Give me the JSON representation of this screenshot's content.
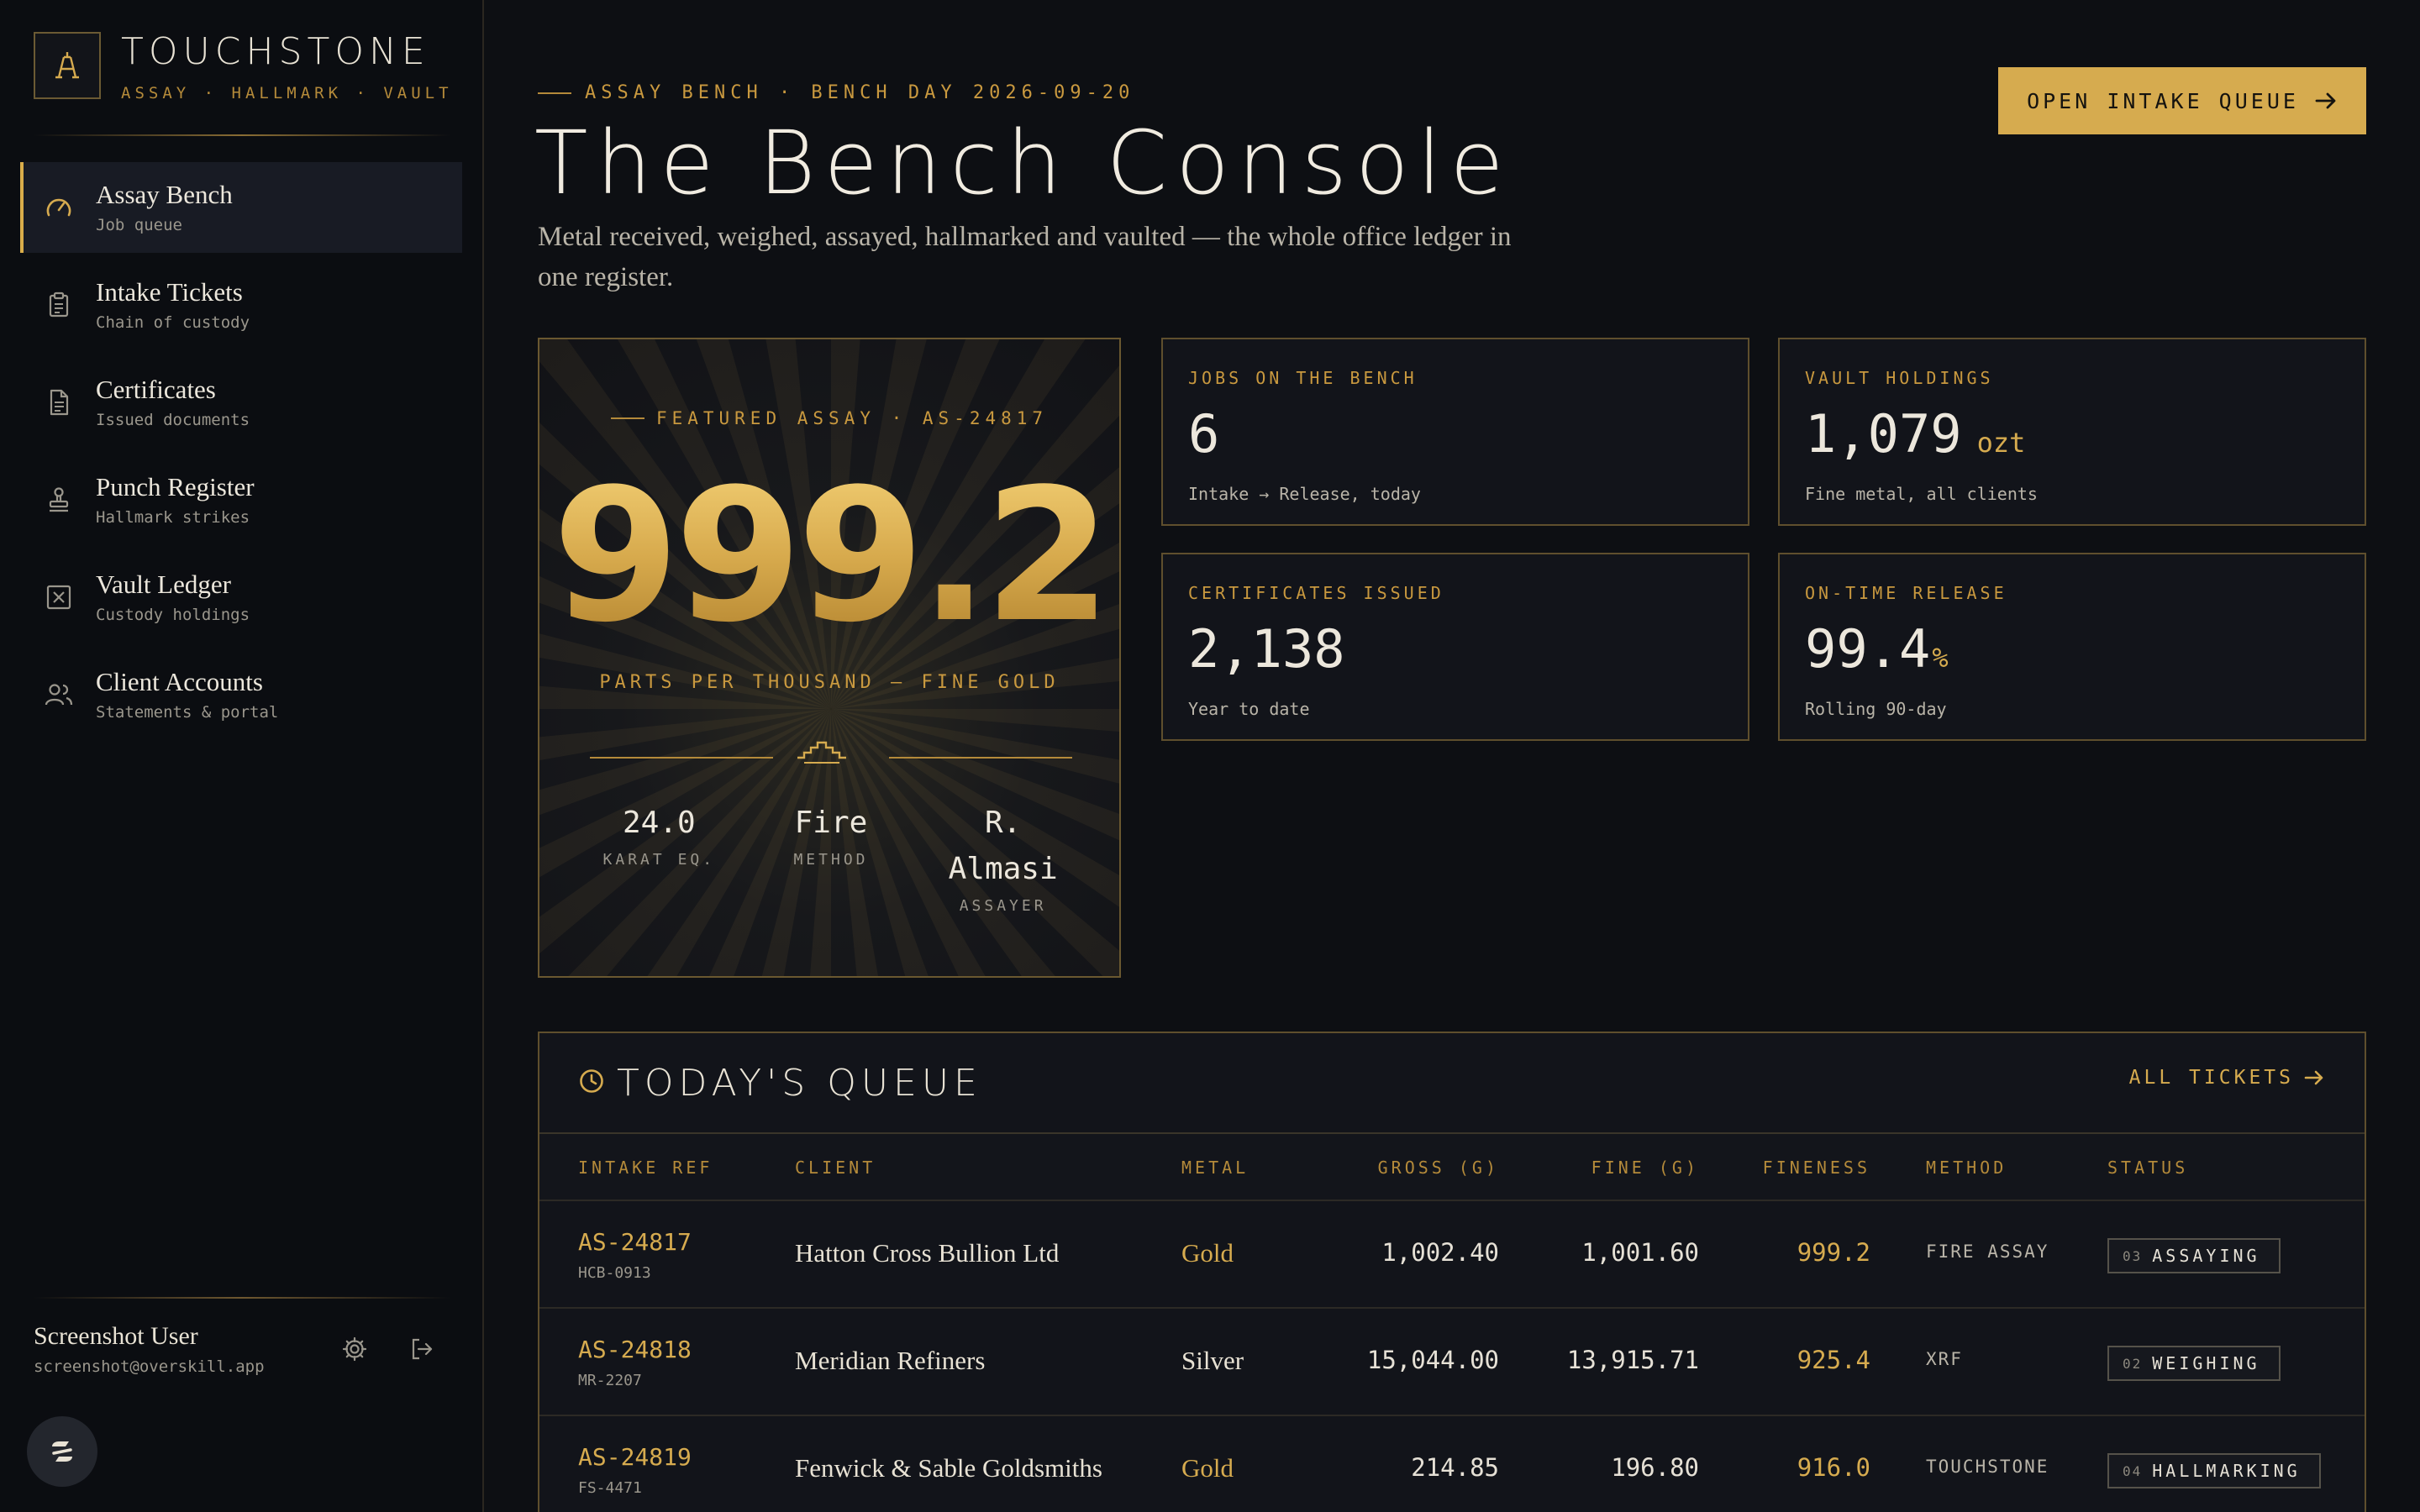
{
  "brand": {
    "name": "TOUCHSTONE",
    "tagline": "ASSAY · HALLMARK · VAULT"
  },
  "sidebar": {
    "items": [
      {
        "label": "Assay Bench",
        "sub": "Job queue",
        "icon": "gauge-icon",
        "active": true
      },
      {
        "label": "Intake Tickets",
        "sub": "Chain of custody",
        "icon": "clipboard-icon"
      },
      {
        "label": "Certificates",
        "sub": "Issued documents",
        "icon": "document-icon"
      },
      {
        "label": "Punch Register",
        "sub": "Hallmark strikes",
        "icon": "stamp-icon"
      },
      {
        "label": "Vault Ledger",
        "sub": "Custody holdings",
        "icon": "vault-icon"
      },
      {
        "label": "Client Accounts",
        "sub": "Statements & portal",
        "icon": "users-icon"
      }
    ]
  },
  "user": {
    "name": "Screenshot User",
    "email": "screenshot@overskill.app"
  },
  "header": {
    "eyebrow": "ASSAY BENCH · BENCH DAY 2026-09-20",
    "title": "The Bench Console",
    "description": "Metal received, weighed, assayed, hallmarked and vaulted — the whole office ledger in one register.",
    "cta_label": "OPEN INTAKE QUEUE"
  },
  "featured": {
    "eyebrow": "FEATURED ASSAY · AS-24817",
    "value": "999.2",
    "unit_label": "PARTS PER THOUSAND — FINE GOLD",
    "stats": [
      {
        "value": "24.0",
        "label": "KARAT EQ."
      },
      {
        "value": "Fire",
        "label": "METHOD"
      },
      {
        "value": "R. Almasi",
        "label": "ASSAYER"
      }
    ]
  },
  "kpis": [
    {
      "label": "JOBS ON THE BENCH",
      "value": "6",
      "unit": "",
      "sub": "Intake → Release, today"
    },
    {
      "label": "VAULT HOLDINGS",
      "value": "1,079",
      "unit": "ozt",
      "sub": "Fine metal, all clients"
    },
    {
      "label": "CERTIFICATES ISSUED",
      "value": "2,138",
      "unit": "",
      "sub": "Year to date"
    },
    {
      "label": "ON-TIME RELEASE",
      "value": "99.4",
      "unit": "%",
      "sub": "Rolling 90-day"
    }
  ],
  "queue": {
    "title": "TODAY'S QUEUE",
    "all_label": "ALL TICKETS",
    "columns": [
      "INTAKE REF",
      "CLIENT",
      "METAL",
      "GROSS (G)",
      "FINE (G)",
      "FINENESS",
      "METHOD",
      "STATUS"
    ],
    "rows": [
      {
        "ref": "AS-24817",
        "sub": "HCB-0913",
        "client": "Hatton Cross Bullion Ltd",
        "metal": "Gold",
        "gross": "1,002.40",
        "fine": "1,001.60",
        "fineness": "999.2",
        "method": "FIRE ASSAY",
        "step": "03",
        "status": "ASSAYING"
      },
      {
        "ref": "AS-24818",
        "sub": "MR-2207",
        "client": "Meridian Refiners",
        "metal": "Silver",
        "gross": "15,044.00",
        "fine": "13,915.71",
        "fineness": "925.4",
        "method": "XRF",
        "step": "02",
        "status": "WEIGHING"
      },
      {
        "ref": "AS-24819",
        "sub": "FS-4471",
        "client": "Fenwick & Sable Goldsmiths",
        "metal": "Gold",
        "gross": "214.85",
        "fine": "196.80",
        "fineness": "916.0",
        "method": "TOUCHSTONE",
        "step": "04",
        "status": "HALLMARKING"
      }
    ]
  },
  "colors": {
    "accent": "#d6ab4f",
    "background": "#0d0f13",
    "gold_metal": "#d6ab4f",
    "silver_metal": "#e8e2d4"
  }
}
